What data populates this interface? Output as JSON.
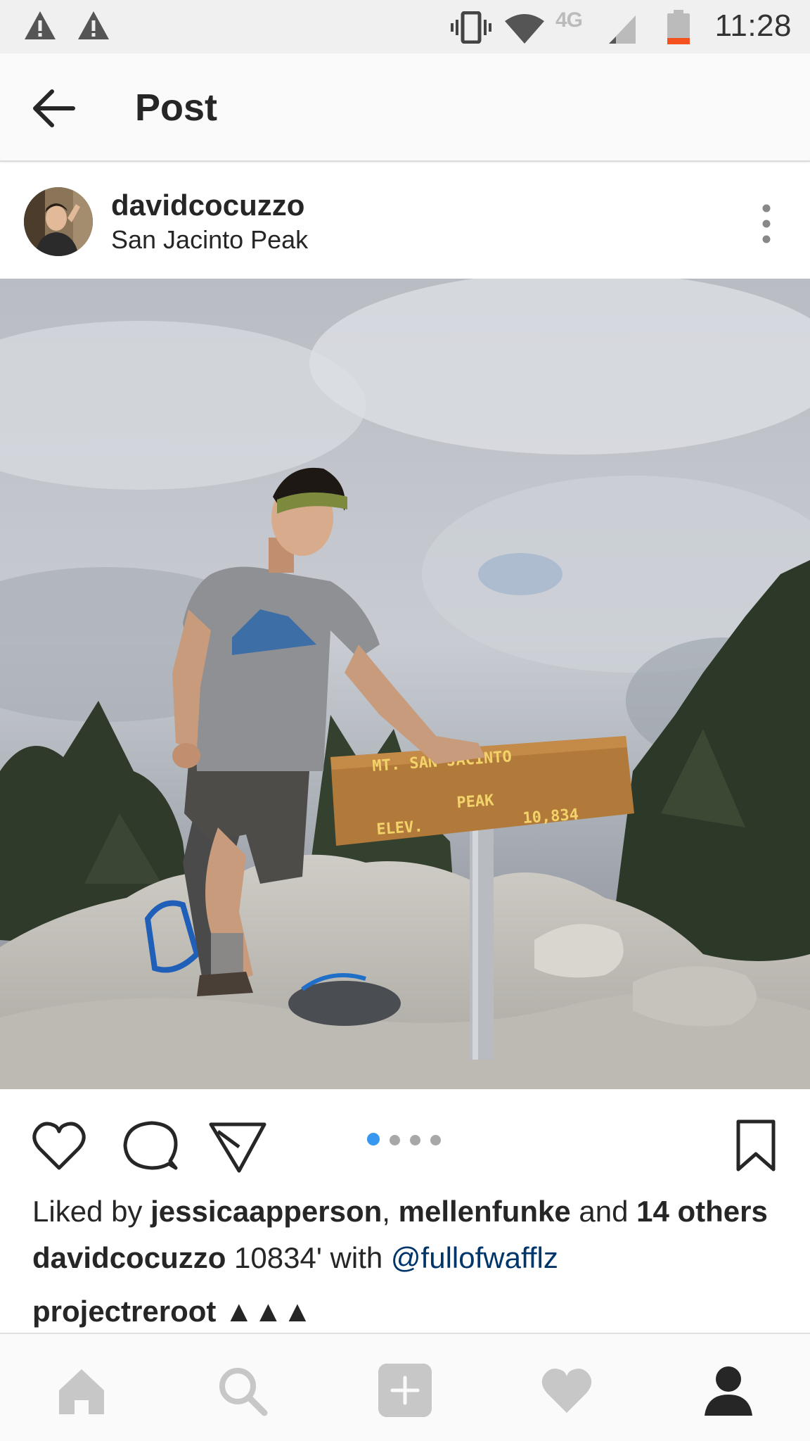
{
  "status_bar": {
    "time": "11:28",
    "network_label": "4G",
    "icons": [
      "warning-icon",
      "warning-icon",
      "vibrate-icon",
      "wifi-icon",
      "signal-icon",
      "battery-icon"
    ]
  },
  "header": {
    "title": "Post"
  },
  "post": {
    "username": "davidcocuzzo",
    "location": "San Jacinto Peak",
    "photo": {
      "sign_line1": "MT.   SAN   JACINTO",
      "sign_line2": "PEAK",
      "sign_line3_left": "ELEV.",
      "sign_line3_right": "10,834"
    },
    "carousel": {
      "count": 4,
      "active_index": 0
    },
    "likes": {
      "prefix": "Liked by ",
      "user1": "jessicaapperson",
      "sep": ", ",
      "user2": "mellenfunke",
      "and": " and ",
      "others": "14 others"
    },
    "caption": {
      "username": "davidcocuzzo",
      "text": " 10834' with ",
      "mention": "@fullofwafflz"
    },
    "comment": {
      "username": "projectreroot",
      "text": " ▲▲▲"
    }
  },
  "colors": {
    "accent": "#3897f0",
    "mention": "#003569",
    "text": "#262626"
  }
}
